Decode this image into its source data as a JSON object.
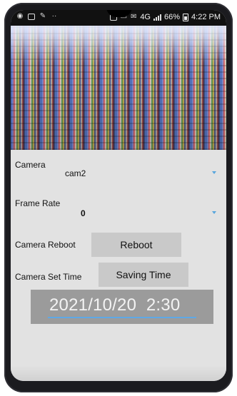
{
  "status_bar": {
    "battery_percent": "66%",
    "time": "4:22 PM",
    "network": "4G",
    "left_icons": [
      "whatsapp-icon",
      "gallery-icon",
      "wrench-icon",
      "more-dots-icon"
    ],
    "right_icons": [
      "sim-icon",
      "message-icon",
      "mail-icon",
      "signal-icon",
      "battery-icon"
    ]
  },
  "form": {
    "camera_label": "Camera",
    "camera_value": "cam2",
    "frame_rate_label": "Frame Rate",
    "frame_rate_value": "0",
    "camera_reboot_label": "Camera Reboot",
    "reboot_button": "Reboot",
    "camera_set_time_label": "Camera Set Time",
    "saving_time_button": "Saving Time",
    "datetime_value": "2021/10/20  2:30"
  },
  "colors": {
    "accent": "#58a6dd",
    "button_bg": "#c9c9c9",
    "panel_bg": "#e2e2e2",
    "datetime_box_bg": "#9b9b9b"
  }
}
